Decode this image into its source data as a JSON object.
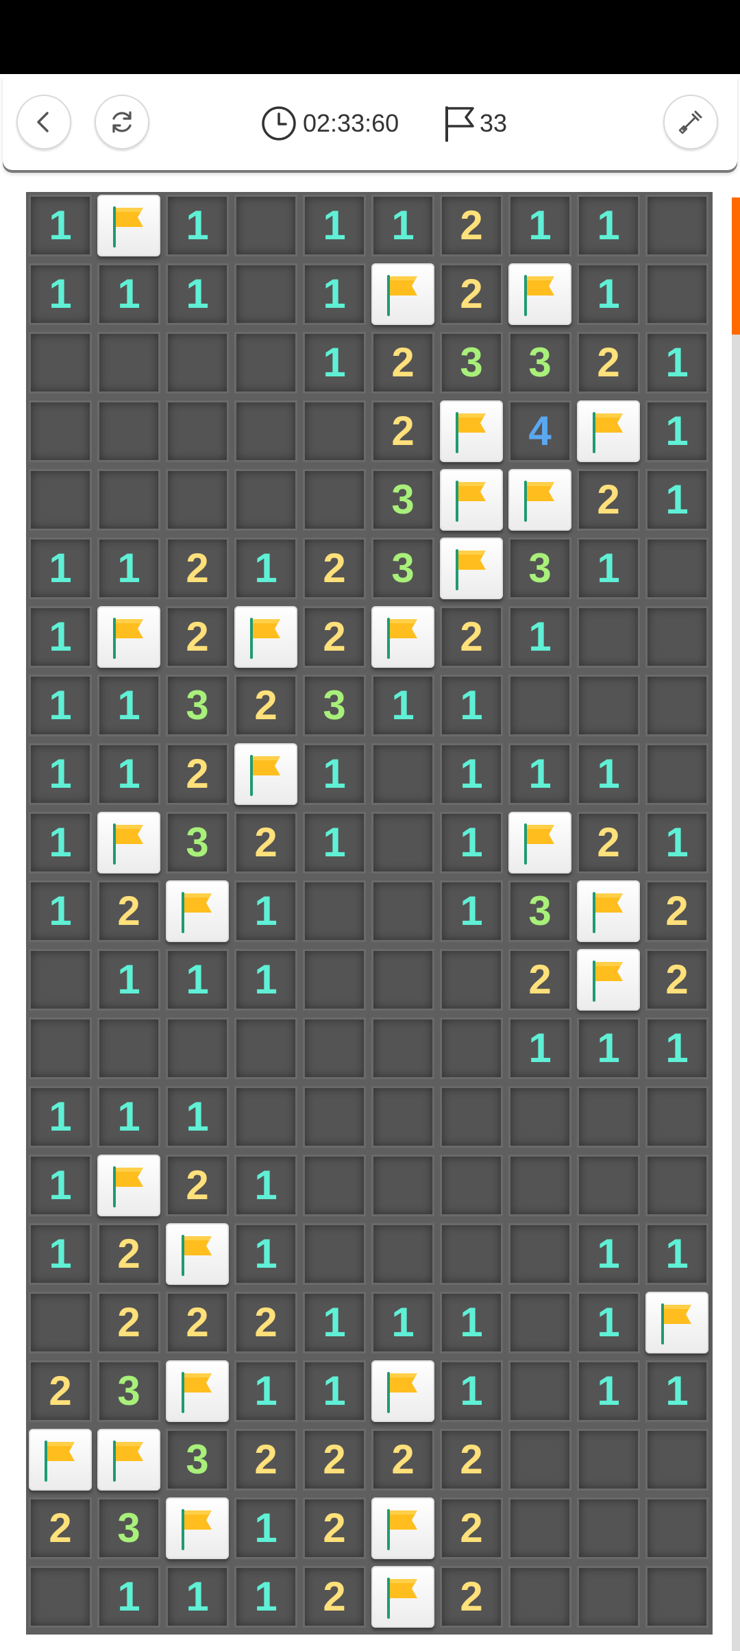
{
  "header": {
    "timer": "02:33:60",
    "flag_count": "33"
  },
  "icons": {
    "back": "chevron-left-icon",
    "restart": "refresh-icon",
    "timer": "clock-icon",
    "flags": "flag-outline-icon",
    "tool": "shovel-icon",
    "cell_flag": "flag-icon"
  },
  "colors": {
    "n1": "#5ff0d6",
    "n2": "#ffe07a",
    "n3": "#a8f07a",
    "n4": "#5aa8f0",
    "flag_yellow": "#ffbe1e",
    "accent": "#ff6a00"
  },
  "board": {
    "cols": 10,
    "rows": 21,
    "grid": [
      [
        "1",
        "F",
        "1",
        "",
        "1",
        "1",
        "2",
        "1",
        "1",
        ""
      ],
      [
        "1",
        "1",
        "1",
        "",
        "1",
        "F",
        "2",
        "F",
        "1",
        ""
      ],
      [
        "",
        "",
        "",
        "",
        "1",
        "2",
        "3",
        "3",
        "2",
        "1"
      ],
      [
        "",
        "",
        "",
        "",
        "",
        "2",
        "F",
        "4",
        "F",
        "1"
      ],
      [
        "",
        "",
        "",
        "",
        "",
        "3",
        "F",
        "F",
        "2",
        "1"
      ],
      [
        "1",
        "1",
        "2",
        "1",
        "2",
        "3",
        "F",
        "3",
        "1",
        ""
      ],
      [
        "1",
        "F",
        "2",
        "F",
        "2",
        "F",
        "2",
        "1",
        "",
        ""
      ],
      [
        "1",
        "1",
        "3",
        "2",
        "3",
        "1",
        "1",
        "",
        "",
        ""
      ],
      [
        "1",
        "1",
        "2",
        "F",
        "1",
        "",
        "1",
        "1",
        "1",
        ""
      ],
      [
        "1",
        "F",
        "3",
        "2",
        "1",
        "",
        "1",
        "F",
        "2",
        "1"
      ],
      [
        "1",
        "2",
        "F",
        "1",
        "",
        "",
        "1",
        "3",
        "F",
        "2"
      ],
      [
        "",
        "1",
        "1",
        "1",
        "",
        "",
        "",
        "2",
        "F",
        "2"
      ],
      [
        "",
        "",
        "",
        "",
        "",
        "",
        "",
        "1",
        "1",
        "1"
      ],
      [
        "1",
        "1",
        "1",
        "",
        "",
        "",
        "",
        "",
        "",
        ""
      ],
      [
        "1",
        "F",
        "2",
        "1",
        "",
        "",
        "",
        "",
        "",
        ""
      ],
      [
        "1",
        "2",
        "F",
        "1",
        "",
        "",
        "",
        "",
        "1",
        "1"
      ],
      [
        "",
        "2",
        "2",
        "2",
        "1",
        "1",
        "1",
        "",
        "1",
        "F"
      ],
      [
        "2",
        "3",
        "F",
        "1",
        "1",
        "F",
        "1",
        "",
        "1",
        "1"
      ],
      [
        "F",
        "F",
        "3",
        "2",
        "2",
        "2",
        "2",
        "",
        "",
        ""
      ],
      [
        "2",
        "3",
        "F",
        "1",
        "2",
        "F",
        "2",
        "",
        "",
        ""
      ],
      [
        "",
        "1",
        "1",
        "1",
        "2",
        "F",
        "2",
        "",
        "",
        ""
      ]
    ]
  }
}
